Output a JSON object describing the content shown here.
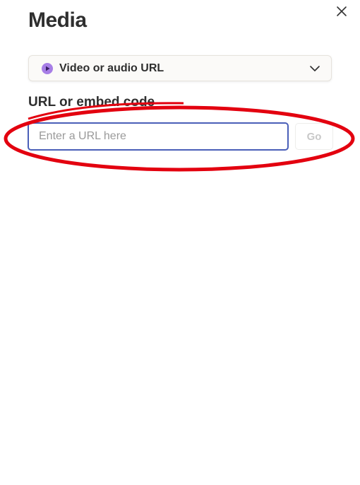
{
  "dialog": {
    "title": "Media"
  },
  "source_select": {
    "selected": "Video or audio URL",
    "icon": "play-circle-icon",
    "icon_color": "#9b6bd8"
  },
  "url_section": {
    "label": "URL or embed code",
    "placeholder": "Enter a URL here",
    "value": ""
  },
  "go_button": {
    "label": "Go",
    "disabled": true
  },
  "annotation": {
    "shape": "ellipse",
    "color": "#e3000f"
  },
  "colors": {
    "input_focus_border": "#4a5fb8"
  }
}
